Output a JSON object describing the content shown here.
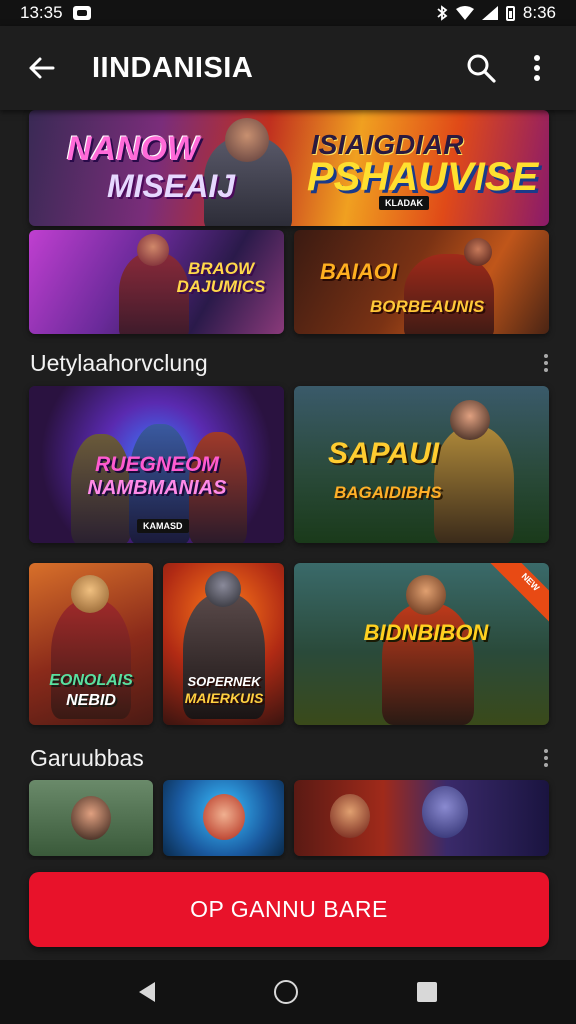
{
  "status_bar": {
    "time": "13:35",
    "right_time": "8:36",
    "icons": [
      "notification-icon",
      "bluetooth-icon",
      "wifi-icon",
      "signal-icon",
      "battery-icon"
    ]
  },
  "app_bar": {
    "title": "IINDANISIA",
    "icons": [
      "back-arrow-icon",
      "search-icon",
      "more-vert-icon"
    ]
  },
  "banners": [
    {
      "title_line1": "NANOW",
      "title_line2": "MISEAIJ"
    },
    {
      "title_line1": "ISIAIGDIAR",
      "title_line2": "PSHAUVISE",
      "sub": "KLADAK"
    }
  ],
  "featured_row": [
    {
      "title": "BRAOW DAJUMICS"
    },
    {
      "title_top": "BAIAOI",
      "title_bottom": "BORBEAUNIS"
    }
  ],
  "sections": [
    {
      "title": "Uetylaahorvclung"
    },
    {
      "title": "Garuubbas"
    }
  ],
  "grid_cards": [
    {
      "title_line1": "RUEGNEOM",
      "title_line2": "NAMBMANIAS",
      "sub": "KAMASD"
    },
    {
      "title_top": "SAPAUI",
      "title_bottom": "BAGAIDIBHS"
    },
    {
      "title_line1": "EONOLAIS",
      "title_line2": "NEBID"
    },
    {
      "title_line1": "SOPERNEK",
      "title_line2": "MAIERKUIS"
    },
    {
      "title": "BIDNBIBON",
      "badge": "NEW"
    }
  ],
  "cta": {
    "label": "OP GANNU BARE"
  },
  "colors": {
    "background": "#1e1e1e",
    "app_bar": "#1e1e1e",
    "status_bar": "#121212",
    "cta": "#e8122a"
  }
}
